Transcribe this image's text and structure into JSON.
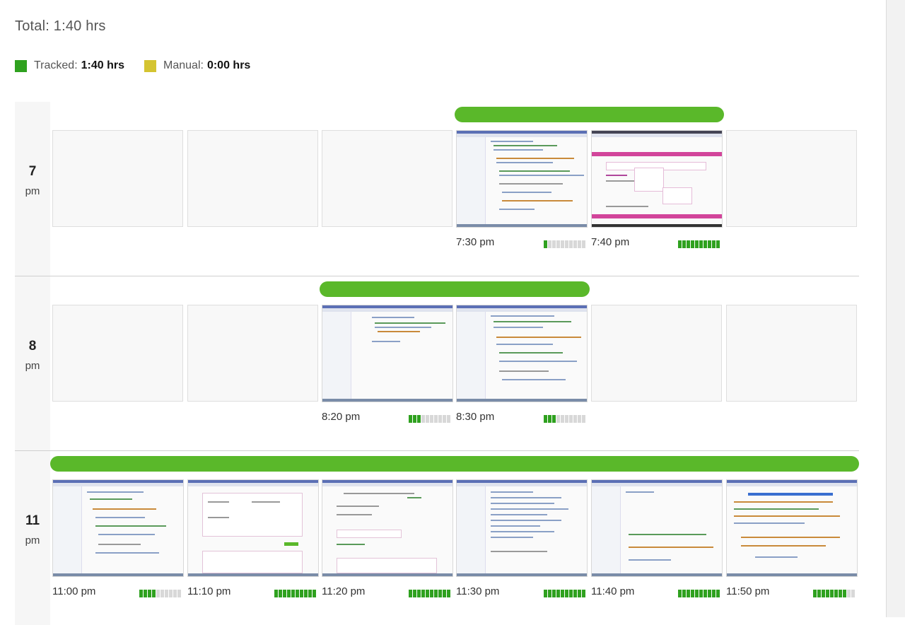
{
  "total_label": "Total: 1:40 hrs",
  "legend": {
    "tracked_label": "Tracked:",
    "tracked_value": "1:40 hrs",
    "tracked_color": "#2fa11f",
    "manual_label": "Manual:",
    "manual_value": "0:00 hrs",
    "manual_color": "#d4c431"
  },
  "colors": {
    "track_bar": "#5ab82a",
    "activity_on": "#2fa11f",
    "activity_off": "#d8d8d8"
  },
  "hours": [
    {
      "hour": "7",
      "ampm": "pm",
      "screenshots": [
        {
          "time": "7:30 pm",
          "activity": 1,
          "kind": "code"
        },
        {
          "time": "7:40 pm",
          "activity": 10,
          "kind": "web"
        }
      ]
    },
    {
      "hour": "8",
      "ampm": "pm",
      "screenshots": [
        {
          "time": "8:20 pm",
          "activity": 3,
          "kind": "code"
        },
        {
          "time": "8:30 pm",
          "activity": 3,
          "kind": "code"
        }
      ]
    },
    {
      "hour": "11",
      "ampm": "pm",
      "screenshots": [
        {
          "time": "11:00 pm",
          "activity": 4,
          "kind": "code"
        },
        {
          "time": "11:10 pm",
          "activity": 10,
          "kind": "form"
        },
        {
          "time": "11:20 pm",
          "activity": 10,
          "kind": "form"
        },
        {
          "time": "11:30 pm",
          "activity": 10,
          "kind": "code"
        },
        {
          "time": "11:40 pm",
          "activity": 10,
          "kind": "code"
        },
        {
          "time": "11:50 pm",
          "activity": 8,
          "kind": "code"
        }
      ]
    }
  ]
}
